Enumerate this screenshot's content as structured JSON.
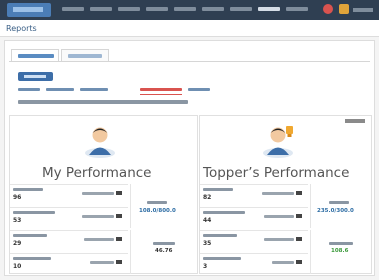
{
  "app": {
    "logo_text": "",
    "nav": [
      "",
      "",
      "",
      "",
      "",
      "",
      "",
      "",
      ""
    ],
    "active_nav_index": 7
  },
  "page": {
    "title": "Reports"
  },
  "tabs": [
    "",
    ""
  ],
  "buttons": {
    "primary": ""
  },
  "subtabs": [
    "",
    "",
    "",
    "",
    ""
  ],
  "active_subtab_index": 3,
  "info_line": "",
  "mine": {
    "heading": "My Performance",
    "stats": [
      {
        "label": "",
        "value": "96",
        "meta": ""
      },
      {
        "label": "",
        "value": "53",
        "meta": ""
      },
      {
        "label": "",
        "value": "29",
        "meta": ""
      },
      {
        "label": "",
        "value": "10",
        "meta": ""
      }
    ],
    "score_label": "",
    "score_value": "108.0/800.0",
    "pct_label": "",
    "pct_value": "46.76"
  },
  "topper": {
    "heading": "Topper’s Performance",
    "corner_label": "",
    "stats": [
      {
        "label": "",
        "value": "82",
        "meta": ""
      },
      {
        "label": "",
        "value": "44",
        "meta": ""
      },
      {
        "label": "",
        "value": "35",
        "meta": ""
      },
      {
        "label": "",
        "value": "3",
        "meta": ""
      }
    ],
    "score_label": "",
    "score_value": "235.0/300.0",
    "pct_label": "",
    "pct_value": "108.6"
  },
  "colors": {
    "accent": "#3d6ea8",
    "score_mine": "#2e6da4",
    "score_topper": "#2e6da4",
    "pct_mine": "#333333",
    "pct_topper": "#3c9a3c"
  }
}
